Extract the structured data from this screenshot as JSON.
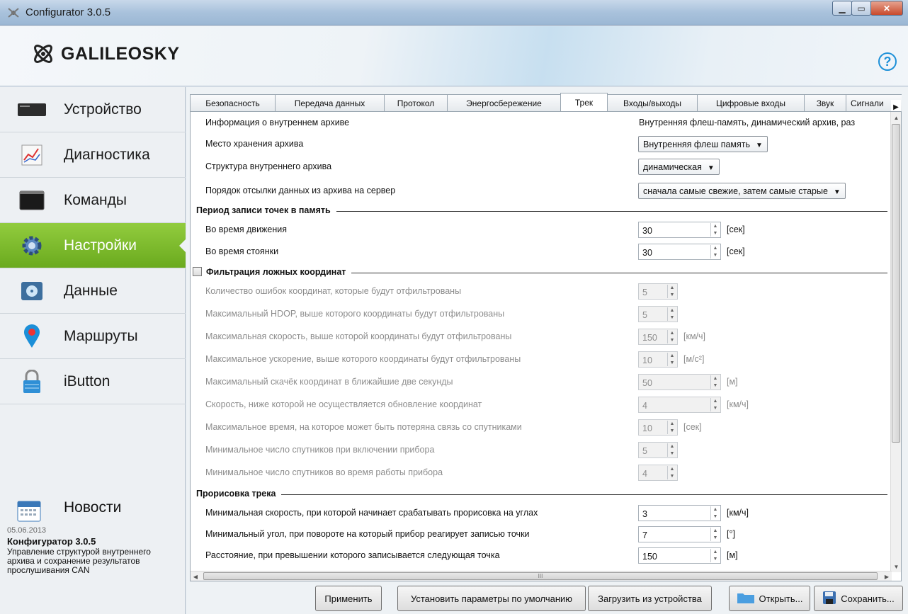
{
  "window": {
    "title": "Configurator 3.0.5"
  },
  "header": {
    "logo_text_a": "GALILEO",
    "logo_text_b": "SKY",
    "help": "?"
  },
  "sidebar": {
    "items": [
      {
        "label": "Устройство",
        "icon": "device-icon"
      },
      {
        "label": "Диагностика",
        "icon": "diagnostics-chart-icon"
      },
      {
        "label": "Команды",
        "icon": "terminal-icon"
      },
      {
        "label": "Настройки",
        "icon": "gear-icon",
        "active": true
      },
      {
        "label": "Данные",
        "icon": "disk-icon"
      },
      {
        "label": "Маршруты",
        "icon": "map-pin-icon"
      },
      {
        "label": "iButton",
        "icon": "lock-icon"
      }
    ],
    "news": {
      "title": "Новости",
      "date": "05.06.2013",
      "headline": "Конфигуратор 3.0.5",
      "body": "Управление структурой внутреннего архива и сохранение результатов прослушивания CAN"
    }
  },
  "tabs": [
    "Безопасность",
    "Передача данных",
    "Протокол",
    "Энергосбережение",
    "Трек",
    "Входы/выходы",
    "Цифровые входы",
    "Звук",
    "Сигнали"
  ],
  "active_tab": "Трек",
  "archive": {
    "info_label": "Информация о внутреннем архиве",
    "info_value": "Внутренняя флеш-память, динамический архив, раз",
    "storage_label": "Место хранения архива",
    "storage_value": "Внутренняя флеш память",
    "structure_label": "Структура внутреннего архива",
    "structure_value": "динамическая",
    "order_label": "Порядок отсылки данных из архива на сервер",
    "order_value": "сначала самые свежие, затем самые старые"
  },
  "period": {
    "title": "Период записи точек в память",
    "moving_label": "Во время движения",
    "moving_value": "30",
    "moving_unit": "[сек]",
    "parked_label": "Во время стоянки",
    "parked_value": "30",
    "parked_unit": "[сек]"
  },
  "filter": {
    "title": "Фильтрация ложных координат",
    "checked": false,
    "rows": [
      {
        "label": "Количество ошибок координат, которые будут отфильтрованы",
        "value": "5",
        "unit": ""
      },
      {
        "label": "Максимальный HDOP, выше которого координаты будут отфильтрованы",
        "value": "5",
        "unit": ""
      },
      {
        "label": "Максимальная скорость, выше которой координаты будут отфильтрованы",
        "value": "150",
        "unit": "[км/ч]"
      },
      {
        "label": "Максимальное ускорение, выше которого координаты будут отфильтрованы",
        "value": "10",
        "unit": "[м/с²]"
      },
      {
        "label": "Максимальный скачёк координат в ближайшие две секунды",
        "value": "50",
        "unit": "[м]"
      },
      {
        "label": "Скорость, ниже которой не осуществляется обновление координат",
        "value": "4",
        "unit": "[км/ч]"
      },
      {
        "label": "Максимальное время, на которое может быть потеряна связь со спутниками",
        "value": "10",
        "unit": "[сек]"
      },
      {
        "label": "Минимальное число спутников при включении прибора",
        "value": "5",
        "unit": ""
      },
      {
        "label": "Минимальное число спутников во время работы прибора",
        "value": "4",
        "unit": ""
      }
    ]
  },
  "track": {
    "title": "Прорисовка трека",
    "rows": [
      {
        "label": "Минимальная скорость, при которой начинает срабатывать прорисовка на углах",
        "value": "3",
        "unit": "[км/ч]"
      },
      {
        "label": "Минимальный угол, при повороте на который прибор реагирует записью точки",
        "value": "7",
        "unit": "[°]"
      },
      {
        "label": "Расстояние, при превышении которого записывается следующая точка",
        "value": "150",
        "unit": "[м]"
      }
    ]
  },
  "buttons": {
    "apply": "Применить",
    "defaults": "Установить параметры по умолчанию",
    "load": "Загрузить из устройства",
    "open": "Открыть...",
    "save": "Сохранить..."
  },
  "scroll": {
    "hthumb_mark": "III"
  }
}
